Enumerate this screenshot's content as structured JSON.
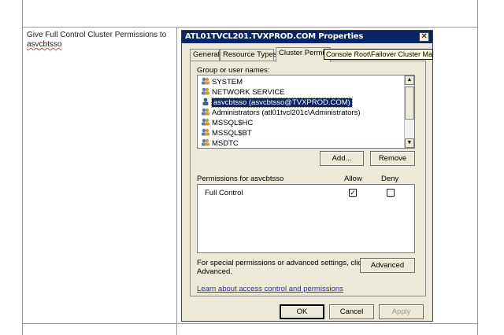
{
  "document": {
    "cell_text": "Give Full Control Cluster Permissions to",
    "cell_text_2": "asvcbtsso"
  },
  "dialog": {
    "title": "ATL01TVCL201.TVXPROD.COM Properties",
    "close_label": "✕",
    "tabs": [
      {
        "label": "General"
      },
      {
        "label": "Resource Types"
      },
      {
        "label": "Cluster Permissi"
      }
    ],
    "tooltip": "Console Root\\Failover Cluster Mana",
    "group_label": "Group or user names:",
    "users": [
      {
        "name": "SYSTEM",
        "icon": "group-icon"
      },
      {
        "name": "NETWORK SERVICE",
        "icon": "group-icon"
      },
      {
        "name": "asvcbtsso (asvcbtsso@TVXPROD.COM)",
        "icon": "user-icon",
        "selected": true
      },
      {
        "name": "Administrators (atl01tvcl201c\\Administrators)",
        "icon": "group-icon"
      },
      {
        "name": "MSSQL$HC",
        "icon": "group-icon"
      },
      {
        "name": "MSSQL$BT",
        "icon": "group-icon"
      },
      {
        "name": "MSDTC",
        "icon": "group-icon"
      }
    ],
    "add_label": "Add...",
    "remove_label": "Remove",
    "permissions_label": "Permissions for asvcbtsso",
    "allow_label": "Allow",
    "deny_label": "Deny",
    "permissions": [
      {
        "name": "Full Control",
        "allow": true,
        "deny": false
      }
    ],
    "special_text_1": "For special permissions or advanced settings, click",
    "special_text_2": "Advanced.",
    "advanced_label": "Advanced",
    "learn_link": "Learn about access control and permissions",
    "ok_label": "OK",
    "cancel_label": "Cancel",
    "apply_label": "Apply"
  },
  "colors": {
    "titlebar": "#0a246a",
    "dialog_bg": "#ece9d8",
    "tooltip_bg": "#ffffe1",
    "link": "#1b34c8"
  }
}
